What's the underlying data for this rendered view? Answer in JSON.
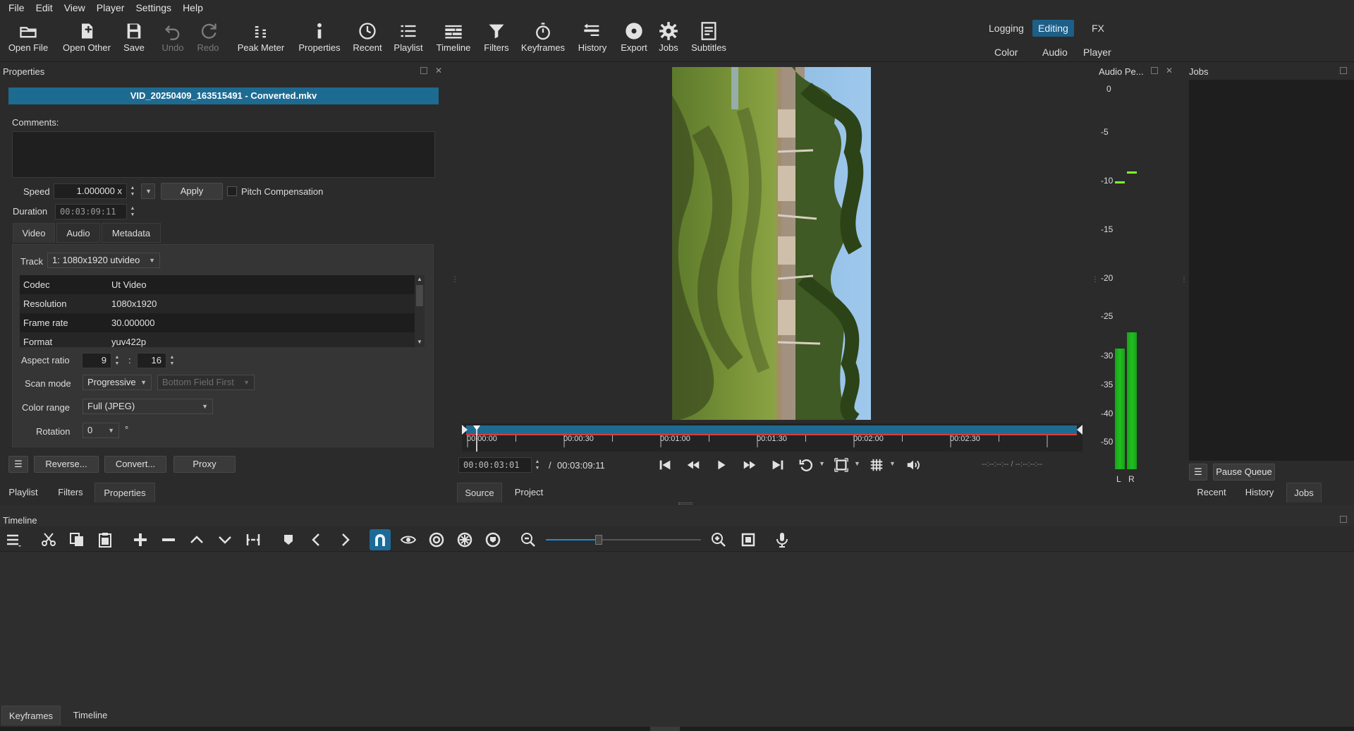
{
  "menu": [
    "File",
    "Edit",
    "View",
    "Player",
    "Settings",
    "Help"
  ],
  "toolbar": {
    "buttons": [
      {
        "label": "Open File",
        "icon": "folder-open-icon"
      },
      {
        "label": "Open Other",
        "icon": "open-other-icon"
      },
      {
        "label": "Save",
        "icon": "save-icon"
      },
      {
        "label": "Undo",
        "icon": "undo-icon"
      },
      {
        "label": "Redo",
        "icon": "redo-icon"
      },
      {
        "label": "Peak Meter",
        "icon": "peak-meter-icon"
      },
      {
        "label": "Properties",
        "icon": "info-icon"
      },
      {
        "label": "Recent",
        "icon": "clock-icon"
      },
      {
        "label": "Playlist",
        "icon": "list-icon"
      },
      {
        "label": "Timeline",
        "icon": "timeline-icon"
      },
      {
        "label": "Filters",
        "icon": "funnel-icon"
      },
      {
        "label": "Keyframes",
        "icon": "stopwatch-icon"
      },
      {
        "label": "History",
        "icon": "history-icon"
      },
      {
        "label": "Export",
        "icon": "disc-icon"
      },
      {
        "label": "Jobs",
        "icon": "gear-icon"
      },
      {
        "label": "Subtitles",
        "icon": "subtitles-icon"
      }
    ],
    "layouts": {
      "logging": "Logging",
      "editing": "Editing",
      "fx": "FX",
      "color": "Color",
      "audio": "Audio",
      "player": "Player"
    }
  },
  "properties": {
    "title": "Properties",
    "file_name": "VID_20250409_163515491 - Converted.mkv",
    "comments_label": "Comments:",
    "speed_label": "Speed",
    "speed_value": "1.000000 x",
    "apply_label": "Apply",
    "pitch_label": "Pitch Compensation",
    "duration_label": "Duration",
    "duration_value": "00:03:09:11",
    "tabs": [
      "Video",
      "Audio",
      "Metadata"
    ],
    "track_label": "Track",
    "track_value": "1: 1080x1920 utvideo",
    "info": [
      {
        "key": "Codec",
        "value": "Ut Video"
      },
      {
        "key": "Resolution",
        "value": "1080x1920"
      },
      {
        "key": "Frame rate",
        "value": "30.000000"
      },
      {
        "key": "Format",
        "value": "yuv422p"
      }
    ],
    "aspect_label": "Aspect ratio",
    "aspect_w": "9",
    "aspect_sep": ":",
    "aspect_h": "16",
    "scan_label": "Scan mode",
    "scan_value": "Progressive",
    "field_order": "Bottom Field First",
    "color_range_label": "Color range",
    "color_range_value": "Full (JPEG)",
    "rotation_label": "Rotation",
    "rotation_value": "0",
    "rotation_unit": "°",
    "reverse_label": "Reverse...",
    "convert_label": "Convert...",
    "proxy_label": "Proxy"
  },
  "left_tabs": [
    "Playlist",
    "Filters",
    "Properties"
  ],
  "player": {
    "ticks": [
      "00:00:00",
      "00:00:30",
      "00:01:00",
      "00:01:30",
      "00:02:00",
      "00:02:30"
    ],
    "position": "00:00:03:01",
    "separator": "/",
    "total": "00:03:09:11",
    "in_out": "--:--:--:-- / --:--:--:--",
    "tabs": [
      "Source",
      "Project"
    ]
  },
  "audio": {
    "title": "Audio Pe...",
    "scale": [
      "0",
      "-5",
      "-10",
      "-15",
      "-20",
      "-25",
      "-30",
      "-35",
      "-40",
      "-50"
    ],
    "channels": [
      "L",
      "R"
    ],
    "levels_db": {
      "L": -29,
      "R": -27
    },
    "peaks_db": {
      "L": -10,
      "R": -9
    }
  },
  "jobs": {
    "title": "Jobs",
    "pause_label": "Pause Queue",
    "tabs": [
      "Recent",
      "History",
      "Jobs"
    ]
  },
  "timeline": {
    "title": "Timeline",
    "zoom_fraction": 0.34
  },
  "bottom_tabs": [
    "Keyframes",
    "Timeline"
  ],
  "colors": {
    "accent": "#1d6a97",
    "meter": "#1fbf1f",
    "peak": "#7cff2a",
    "scrub": "#1e6b92",
    "in_marker": "#e03a3a"
  }
}
